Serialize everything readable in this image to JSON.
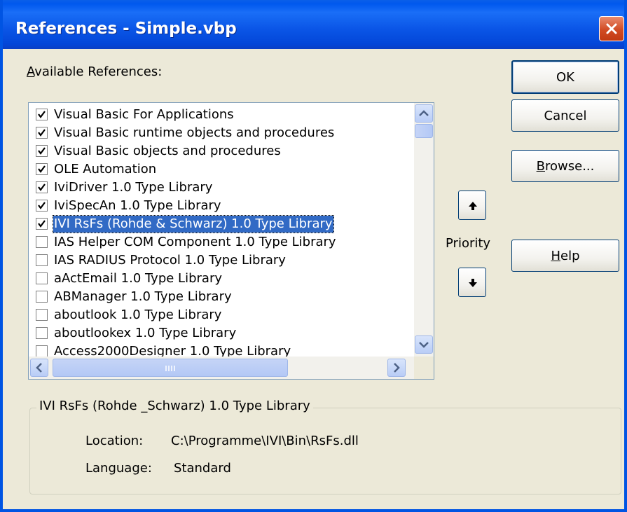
{
  "window": {
    "title": "References - Simple.vbp"
  },
  "available_refs_label": {
    "u": "A",
    "rest": "vailable References:"
  },
  "list_items": [
    {
      "label": "Visual Basic For Applications",
      "checked": true,
      "selected": false
    },
    {
      "label": "Visual Basic runtime objects and procedures",
      "checked": true,
      "selected": false
    },
    {
      "label": "Visual Basic objects and procedures",
      "checked": true,
      "selected": false
    },
    {
      "label": "OLE Automation",
      "checked": true,
      "selected": false
    },
    {
      "label": "IviDriver 1.0 Type Library",
      "checked": true,
      "selected": false
    },
    {
      "label": "IviSpecAn 1.0 Type Library",
      "checked": true,
      "selected": false
    },
    {
      "label": "IVI RsFs (Rohde & Schwarz) 1.0 Type Library",
      "checked": true,
      "selected": true
    },
    {
      "label": " IAS Helper COM Component 1.0 Type Library",
      "checked": false,
      "selected": false
    },
    {
      "label": " IAS RADIUS Protocol 1.0 Type Library",
      "checked": false,
      "selected": false
    },
    {
      "label": "aActEmail 1.0 Type Library",
      "checked": false,
      "selected": false
    },
    {
      "label": "ABManager 1.0 Type Library",
      "checked": false,
      "selected": false
    },
    {
      "label": "aboutlook 1.0 Type Library",
      "checked": false,
      "selected": false
    },
    {
      "label": "aboutlookex 1.0 Type Library",
      "checked": false,
      "selected": false
    },
    {
      "label": "Access2000Designer 1.0 Type Library",
      "checked": false,
      "selected": false
    }
  ],
  "buttons": {
    "ok": "OK",
    "cancel": "Cancel",
    "browse": {
      "u": "B",
      "rest": "rowse..."
    },
    "help": {
      "u": "H",
      "rest": "elp"
    }
  },
  "priority_label": "Priority",
  "details": {
    "group_title": "IVI RsFs (Rohde _Schwarz) 1.0 Type Library",
    "location_label": "Location:",
    "location_value": "C:\\Programme\\IVI\\Bin\\RsFs.dll",
    "language_label": "Language:",
    "language_value": "Standard"
  },
  "colors": {
    "titlebar": "#0058ee",
    "selection": "#316ac5",
    "dialog_bg": "#ece9d8",
    "close_button": "#d14b23"
  }
}
